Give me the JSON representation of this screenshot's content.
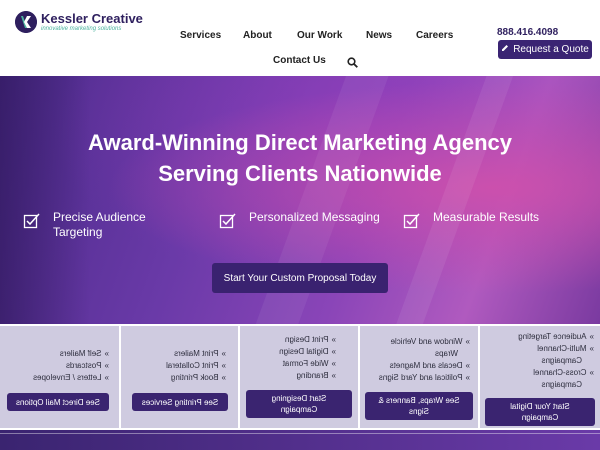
{
  "brand": {
    "name": "Kessler Creative",
    "tagline": "innovative marketing solutions",
    "colors": {
      "primary": "#2e1f5e",
      "accent": "#4db39f",
      "button": "#3a2473"
    }
  },
  "nav": {
    "services": "Services",
    "about": "About",
    "our_work": "Our Work",
    "news": "News",
    "careers": "Careers",
    "contact": "Contact Us",
    "search_icon": "search-icon"
  },
  "contact": {
    "phone": "888.416.4098",
    "quote_label": "Request a Quote"
  },
  "hero": {
    "title_line1": "Award-Winning Direct Marketing Agency",
    "title_line2": "Serving Clients Nationwide",
    "features": [
      {
        "label_line1": "Precise Audience",
        "label_line2": "Targeting",
        "icon": "checklist-icon"
      },
      {
        "label_line1": "Personalized Messaging",
        "label_line2": "",
        "icon": "checklist-icon"
      },
      {
        "label_line1": "Measurable Results",
        "label_line2": "",
        "icon": "checklist-icon"
      }
    ],
    "cta_label": "Start Your Custom Proposal Today"
  },
  "service_panels": [
    {
      "items": [
        "Self Mailers",
        "Postcards",
        "Letters / Envelopes"
      ],
      "button": "See Direct Mail Options"
    },
    {
      "items": [
        "Print Mailers",
        "Print Collateral",
        "Book Printing"
      ],
      "button": "See Printing Services"
    },
    {
      "items": [
        "Print Design",
        "Digital Design",
        "Wide Format",
        "Branding"
      ],
      "button_line1": "Start Designing",
      "button_line2": "Campaign"
    },
    {
      "items": [
        "Window and Vehicle",
        "Wraps",
        "Decals and Magnets",
        "Political and Yard Signs"
      ],
      "button_line1": "See Wraps, Banners &",
      "button_line2": "Signs"
    },
    {
      "items": [
        "Audience Targeting",
        "Multi-Channel",
        "Campaigns",
        "Cross-Channel",
        "Campaigns"
      ],
      "button_line1": "Start Your Digital",
      "button_line2": "Campaign"
    }
  ]
}
